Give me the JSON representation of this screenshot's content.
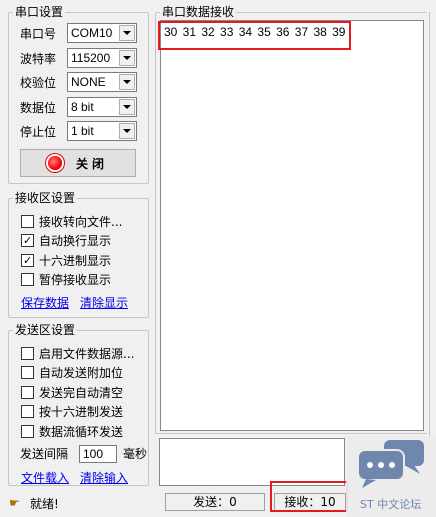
{
  "serial_settings": {
    "title": "串口设置",
    "port_label": "串口号",
    "port_value": "COM10",
    "baud_label": "波特率",
    "baud_value": "115200",
    "parity_label": "校验位",
    "parity_value": "NONE",
    "databits_label": "数据位",
    "databits_value": "8 bit",
    "stopbits_label": "停止位",
    "stopbits_value": "1 bit",
    "close_button_label": "关闭"
  },
  "receive_settings": {
    "title": "接收区设置",
    "options": [
      {
        "label": "接收转向文件...",
        "checked": false
      },
      {
        "label": "自动换行显示",
        "checked": true
      },
      {
        "label": "十六进制显示",
        "checked": true
      },
      {
        "label": "暂停接收显示",
        "checked": false
      }
    ],
    "save_link": "保存数据",
    "clear_link": "清除显示"
  },
  "send_settings": {
    "title": "发送区设置",
    "options": [
      {
        "label": "启用文件数据源...",
        "checked": false
      },
      {
        "label": "自动发送附加位",
        "checked": false
      },
      {
        "label": "发送完自动清空",
        "checked": false
      },
      {
        "label": "按十六进制发送",
        "checked": false
      },
      {
        "label": "数据流循环发送",
        "checked": false
      }
    ],
    "interval_label": "发送间隔",
    "interval_value": "100",
    "interval_unit": "毫秒",
    "load_file_link": "文件载入",
    "clear_input_link": "清除输入"
  },
  "receive_area": {
    "title": "串口数据接收",
    "content": "30 31 32 33 34 35 36 37 38 39"
  },
  "status": {
    "ready": "就绪!",
    "sent": "发送：0",
    "received": "接收：10"
  },
  "watermark": {
    "text": "ST 中文论坛"
  },
  "colors": {
    "highlight": "#e6191f",
    "link": "#0000ee",
    "indicator": "#ff0000"
  }
}
